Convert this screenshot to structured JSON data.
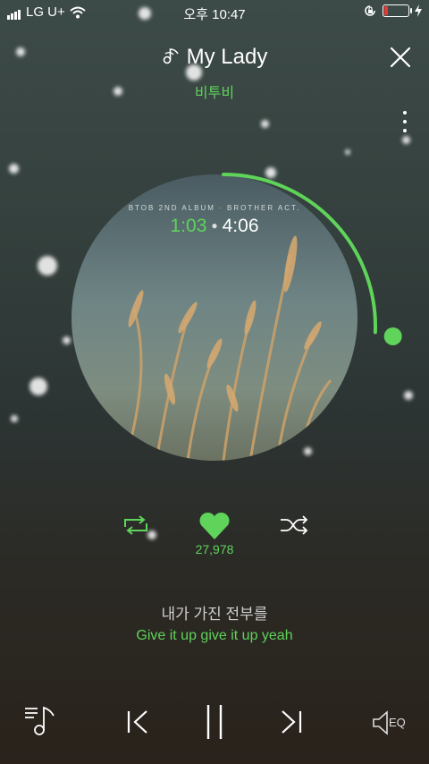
{
  "status_bar": {
    "carrier": "LG U+",
    "time": "오후 10:47"
  },
  "song": {
    "title": "My Lady",
    "artist": "비투비",
    "album_caption": "BTOB 2ND ALBUM · BROTHER ACT.",
    "current_time": "1:03",
    "total_time": "4:06",
    "progress_fraction": 0.256
  },
  "likes": "27,978",
  "lyrics": {
    "current": "내가 가진 전부를",
    "next": "Give it up give it up yeah"
  },
  "controls": {
    "eq_label": "EQ"
  },
  "colors": {
    "accent": "#5fd35a",
    "background_top": "#3d4b48",
    "background_bottom": "#2a221b"
  },
  "icons": [
    "wifi-icon",
    "battery-icon",
    "lock-rotation-icon",
    "charging-icon",
    "music-note-icon",
    "close-icon",
    "more-icon",
    "repeat-icon",
    "heart-icon",
    "shuffle-icon",
    "playlist-icon",
    "previous-icon",
    "pause-icon",
    "next-icon",
    "eq-icon"
  ]
}
